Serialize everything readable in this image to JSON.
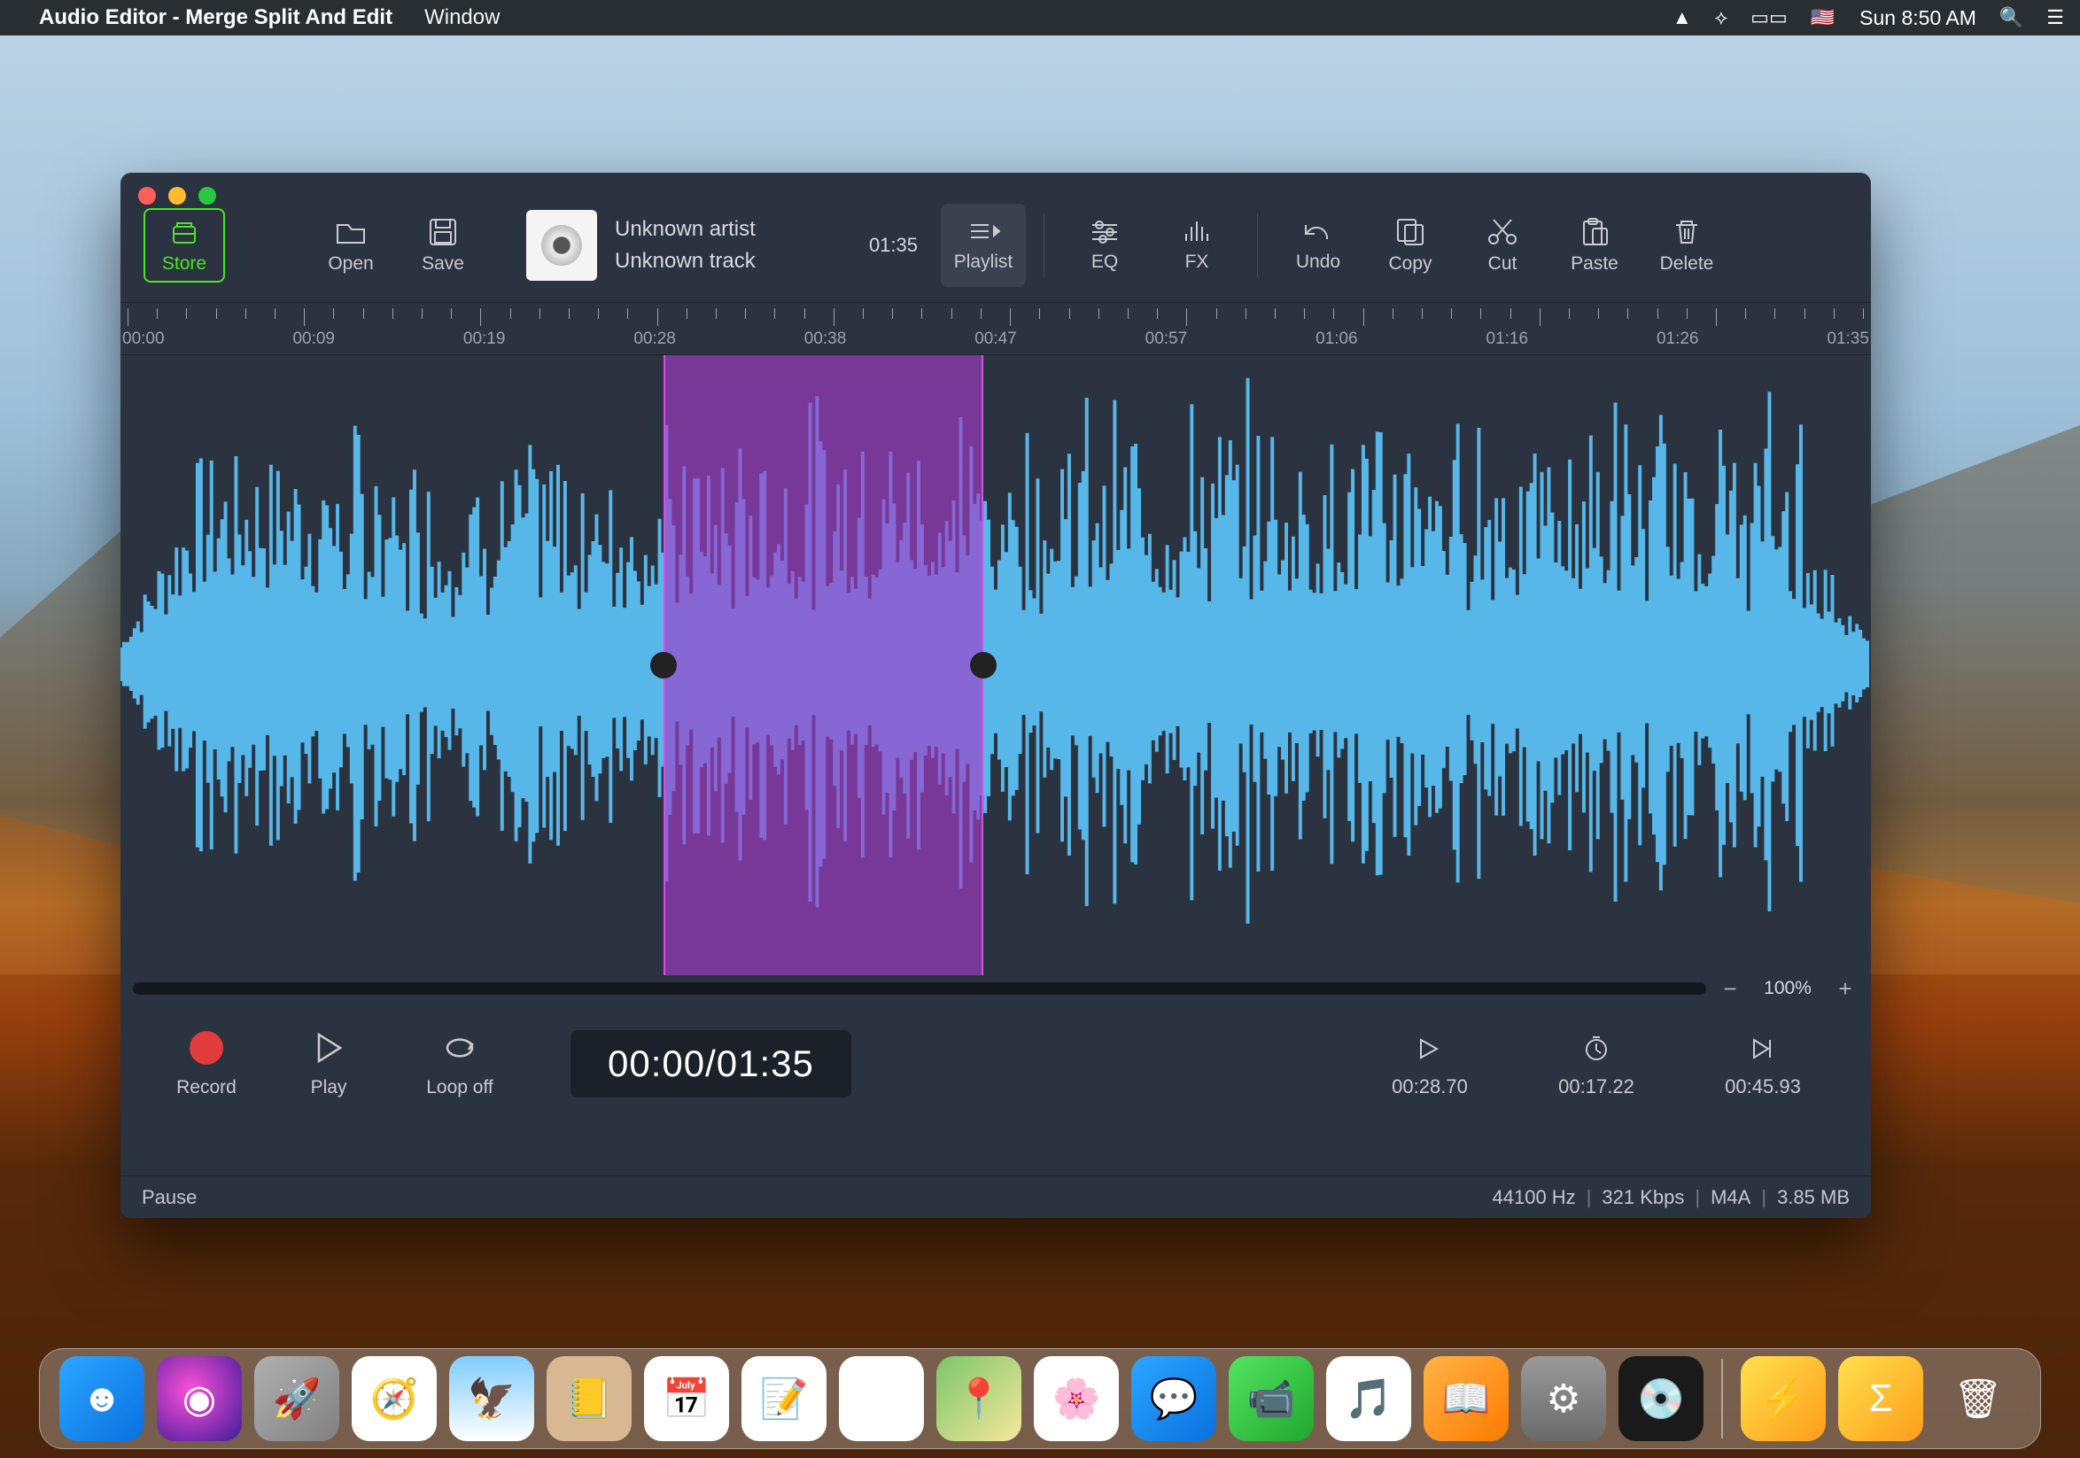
{
  "menubar": {
    "app_name": "Audio Editor - Merge Split And Edit",
    "menu_window": "Window",
    "clock": "Sun 8:50 AM"
  },
  "toolbar": {
    "store": "Store",
    "open": "Open",
    "save": "Save",
    "playlist": "Playlist",
    "eq": "EQ",
    "fx": "FX",
    "undo": "Undo",
    "copy": "Copy",
    "cut": "Cut",
    "paste": "Paste",
    "delete": "Delete"
  },
  "track": {
    "artist": "Unknown artist",
    "title": "Unknown track",
    "duration": "01:35"
  },
  "ruler": {
    "labels": [
      "00:00",
      "00:09",
      "00:19",
      "00:28",
      "00:38",
      "00:47",
      "00:57",
      "01:06",
      "01:16",
      "01:26",
      "01:35"
    ]
  },
  "zoom": {
    "minus": "−",
    "plus": "+",
    "level": "100%"
  },
  "transport": {
    "record": "Record",
    "play": "Play",
    "loop": "Loop off",
    "time": "00:00/01:35"
  },
  "markers": {
    "start": "00:28.70",
    "length": "00:17.22",
    "end": "00:45.93"
  },
  "status": {
    "state": "Pause",
    "rate": "44100 Hz",
    "bitrate": "321 Kbps",
    "format": "M4A",
    "size": "3.85 MB"
  },
  "dock": {
    "apps": [
      {
        "name": "finder",
        "bg": "linear-gradient(135deg,#2aa7ff,#0a6fe0)",
        "glyph": "☻"
      },
      {
        "name": "siri",
        "bg": "radial-gradient(circle at 40% 40%,#ff4fd8,#3a1b99)",
        "glyph": "◉"
      },
      {
        "name": "launchpad",
        "bg": "linear-gradient(135deg,#b0b0b0,#808080)",
        "glyph": "🚀"
      },
      {
        "name": "safari",
        "bg": "#fff",
        "glyph": "🧭"
      },
      {
        "name": "mail",
        "bg": "linear-gradient(180deg,#80ccff,#fff)",
        "glyph": "🦅"
      },
      {
        "name": "contacts",
        "bg": "#d8b893",
        "glyph": "📒"
      },
      {
        "name": "calendar",
        "bg": "#fff",
        "glyph": "📅"
      },
      {
        "name": "notes",
        "bg": "#fff",
        "glyph": "📝"
      },
      {
        "name": "reminders",
        "bg": "#fff",
        "glyph": "☑︎"
      },
      {
        "name": "maps",
        "bg": "linear-gradient(135deg,#7cc66b,#f7e79b)",
        "glyph": "📍"
      },
      {
        "name": "photos",
        "bg": "#fff",
        "glyph": "🌸"
      },
      {
        "name": "messages",
        "bg": "linear-gradient(135deg,#2aa7ff,#0a6fe0)",
        "glyph": "💬"
      },
      {
        "name": "facetime",
        "bg": "linear-gradient(135deg,#54e360,#1fa82e)",
        "glyph": "📹"
      },
      {
        "name": "itunes",
        "bg": "#fff",
        "glyph": "🎵"
      },
      {
        "name": "ibooks",
        "bg": "linear-gradient(135deg,#ffb347,#ff7b00)",
        "glyph": "📖"
      },
      {
        "name": "preferences",
        "bg": "linear-gradient(180deg,#9a9a9a,#6a6a6a)",
        "glyph": "⚙︎"
      },
      {
        "name": "audio-editor",
        "bg": "#1a1a1a",
        "glyph": "💿"
      }
    ],
    "extras": [
      {
        "name": "app1",
        "bg": "linear-gradient(135deg,#ffe14d,#ff9c1a)",
        "glyph": "⚡"
      },
      {
        "name": "app2",
        "bg": "linear-gradient(135deg,#ffe14d,#ff9c1a)",
        "glyph": "Σ"
      },
      {
        "name": "trash",
        "bg": "transparent",
        "glyph": "🗑"
      }
    ]
  }
}
